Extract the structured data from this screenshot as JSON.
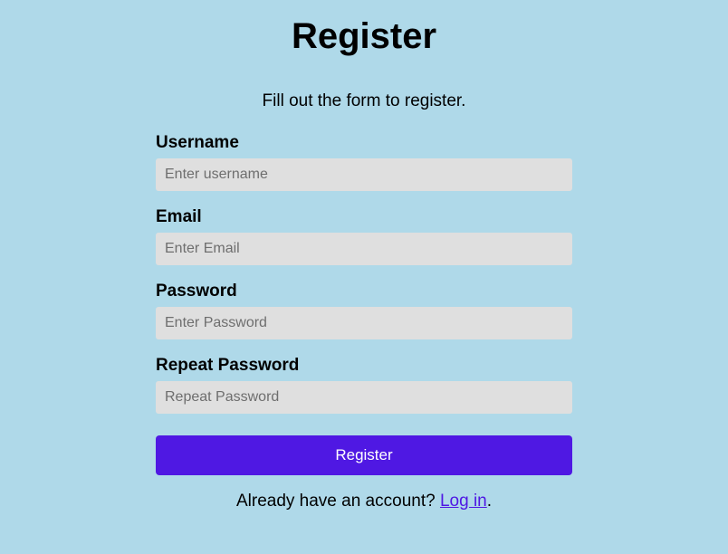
{
  "title": "Register",
  "subtitle": "Fill out the form to register.",
  "fields": {
    "username": {
      "label": "Username",
      "placeholder": "Enter username",
      "value": ""
    },
    "email": {
      "label": "Email",
      "placeholder": "Enter Email",
      "value": ""
    },
    "password": {
      "label": "Password",
      "placeholder": "Enter Password",
      "value": ""
    },
    "repeat_password": {
      "label": "Repeat Password",
      "placeholder": "Repeat Password",
      "value": ""
    }
  },
  "register_button": "Register",
  "login_prompt": "Already have an account? ",
  "login_link": "Log in",
  "login_suffix": "."
}
